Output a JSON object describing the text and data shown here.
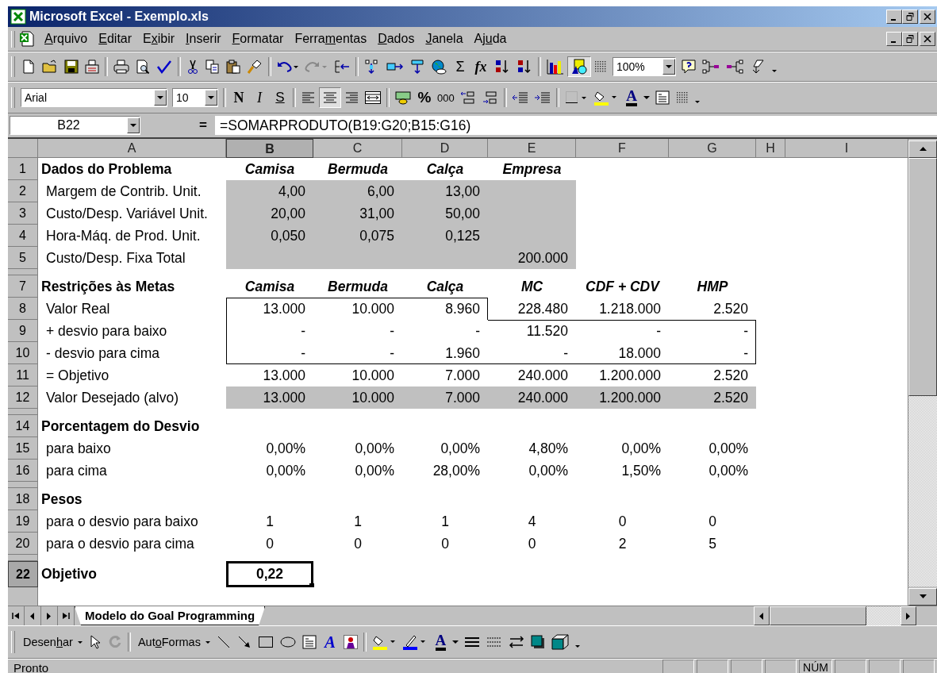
{
  "window": {
    "title": "Microsoft Excel - Exemplo.xls"
  },
  "menu": [
    {
      "key": "A",
      "after": "rquivo"
    },
    {
      "key": "E",
      "after": "ditar"
    },
    {
      "before": "E",
      "key": "x",
      "after": "ibir"
    },
    {
      "key": "I",
      "after": "nserir"
    },
    {
      "key": "F",
      "after": "ormatar"
    },
    {
      "before": "Ferra",
      "key": "m",
      "after": "entas"
    },
    {
      "key": "D",
      "after": "ados"
    },
    {
      "key": "J",
      "after": "anela"
    },
    {
      "before": "Aj",
      "key": "u",
      "after": "da"
    }
  ],
  "standard_toolbar": {
    "sum_symbol": "Σ",
    "function_symbol": "fx",
    "drawing_pressed": true,
    "zoom": "100%"
  },
  "formatting_toolbar": {
    "font": "Arial",
    "size": "10",
    "bold": "N",
    "italic": "I",
    "underline": "S",
    "center_pressed": true,
    "percent": "%",
    "thousands": "000",
    "font_color_letter": "A"
  },
  "formula_bar": {
    "name_box": "B22",
    "equals": "=",
    "formula": "=SOMARPRODUTO(B19:G20;B15:G16)"
  },
  "columns": [
    {
      "label": "A",
      "selected": false
    },
    {
      "label": "B",
      "selected": true
    },
    {
      "label": "C",
      "selected": false
    },
    {
      "label": "D",
      "selected": false
    },
    {
      "label": "E",
      "selected": false
    },
    {
      "label": "F",
      "selected": false
    },
    {
      "label": "G",
      "selected": false
    },
    {
      "label": "H",
      "selected": false
    },
    {
      "label": "I",
      "selected": false
    }
  ],
  "rows": [
    {
      "label": "1",
      "kind": "header",
      "selected": false,
      "cells": [
        "Dados do Problema",
        "Camisa",
        "Bermuda",
        "Calça",
        "Empresa",
        "",
        ""
      ]
    },
    {
      "label": "2",
      "kind": "data",
      "selected": false,
      "cells": [
        "Margem de Contrib. Unit.",
        "4,00",
        "6,00",
        "13,00",
        "",
        "",
        ""
      ],
      "shaded": [
        false,
        true,
        true,
        true,
        true,
        false,
        false
      ]
    },
    {
      "label": "3",
      "kind": "data",
      "selected": false,
      "cells": [
        "Custo/Desp. Variável Unit.",
        "20,00",
        "31,00",
        "50,00",
        "",
        "",
        ""
      ],
      "shaded": [
        false,
        true,
        true,
        true,
        true,
        false,
        false
      ]
    },
    {
      "label": "4",
      "kind": "data",
      "selected": false,
      "cells": [
        "Hora-Máq. de Prod. Unit.",
        "0,050",
        "0,075",
        "0,125",
        "",
        "",
        ""
      ],
      "shaded": [
        false,
        true,
        true,
        true,
        true,
        false,
        false
      ]
    },
    {
      "label": "5",
      "kind": "data",
      "selected": false,
      "cells": [
        "Custo/Desp. Fixa Total",
        "",
        "",
        "",
        "200.000",
        "",
        ""
      ],
      "shaded": [
        false,
        true,
        true,
        true,
        true,
        false,
        false
      ]
    },
    {
      "kind": "collapsed",
      "selected": false
    },
    {
      "label": "7",
      "kind": "header",
      "selected": false,
      "cells": [
        "Restrições às Metas",
        "Camisa",
        "Bermuda",
        "Calça",
        "MC",
        "CDF + CDV",
        "HMP"
      ]
    },
    {
      "label": "8",
      "kind": "data",
      "selected": false,
      "boxed": [
        false,
        true,
        true,
        true,
        false,
        false,
        false
      ],
      "cells": [
        "Valor Real",
        "13.000",
        "10.000",
        "8.960",
        "228.480",
        "1.218.000",
        "2.520"
      ]
    },
    {
      "label": "9",
      "kind": "data",
      "selected": false,
      "boxed": [
        false,
        true,
        true,
        true,
        true,
        true,
        true
      ],
      "cells": [
        "+ desvio para baixo",
        "-",
        "-",
        "-",
        "11.520",
        "-",
        "-"
      ]
    },
    {
      "label": "10",
      "kind": "data",
      "selected": false,
      "boxed": [
        false,
        true,
        true,
        true,
        true,
        true,
        true
      ],
      "cells": [
        "- desvio para cima",
        "-",
        "-",
        "1.960",
        "-",
        "18.000",
        "-"
      ]
    },
    {
      "label": "11",
      "kind": "data",
      "selected": false,
      "cells": [
        "= Objetivo",
        "13.000",
        "10.000",
        "7.000",
        "240.000",
        "1.200.000",
        "2.520"
      ]
    },
    {
      "label": "12",
      "kind": "data",
      "selected": false,
      "cells": [
        "Valor Desejado (alvo)",
        "13.000",
        "10.000",
        "7.000",
        "240.000",
        "1.200.000",
        "2.520"
      ],
      "shaded": [
        false,
        true,
        true,
        true,
        true,
        true,
        true
      ]
    },
    {
      "kind": "collapsed",
      "selected": false
    },
    {
      "label": "14",
      "kind": "section",
      "selected": false,
      "cells": [
        "Porcentagem do Desvio"
      ]
    },
    {
      "label": "15",
      "kind": "data",
      "selected": false,
      "cells": [
        "para baixo",
        "0,00%",
        "0,00%",
        "0,00%",
        "4,80%",
        "0,00%",
        "0,00%"
      ]
    },
    {
      "label": "16",
      "kind": "data",
      "selected": false,
      "cells": [
        "para cima",
        "0,00%",
        "0,00%",
        "28,00%",
        "0,00%",
        "1,50%",
        "0,00%"
      ]
    },
    {
      "kind": "collapsed",
      "selected": false
    },
    {
      "label": "18",
      "kind": "section",
      "selected": false,
      "cells": [
        "Pesos"
      ]
    },
    {
      "label": "19",
      "kind": "weights",
      "selected": false,
      "cells": [
        "para o desvio para baixo",
        "1",
        "1",
        "1",
        "4",
        "0",
        "0"
      ]
    },
    {
      "label": "20",
      "kind": "weights",
      "selected": false,
      "cells": [
        "para o desvio para cima",
        "0",
        "0",
        "0",
        "0",
        "2",
        "5"
      ]
    },
    {
      "kind": "collapsed",
      "selected": false
    },
    {
      "label": "22",
      "kind": "total",
      "selected": true,
      "cells": [
        "Objetivo",
        "0,22"
      ]
    },
    {
      "kind": "cut",
      "selected": false
    }
  ],
  "sheet_tabs": [
    {
      "label": "Modelo do Goal Programming",
      "selected": true
    }
  ],
  "drawing_toolbar": {
    "draw_menu": {
      "before": "Desen",
      "key": "h",
      "after": "ar"
    },
    "autoshapes": {
      "before": "Aut",
      "key": "o",
      "after": "Formas"
    },
    "wordart_letter": "A",
    "font_color_letter": "A"
  },
  "status_bar": {
    "text": "Pronto",
    "indicators": [
      "NÚM"
    ]
  }
}
